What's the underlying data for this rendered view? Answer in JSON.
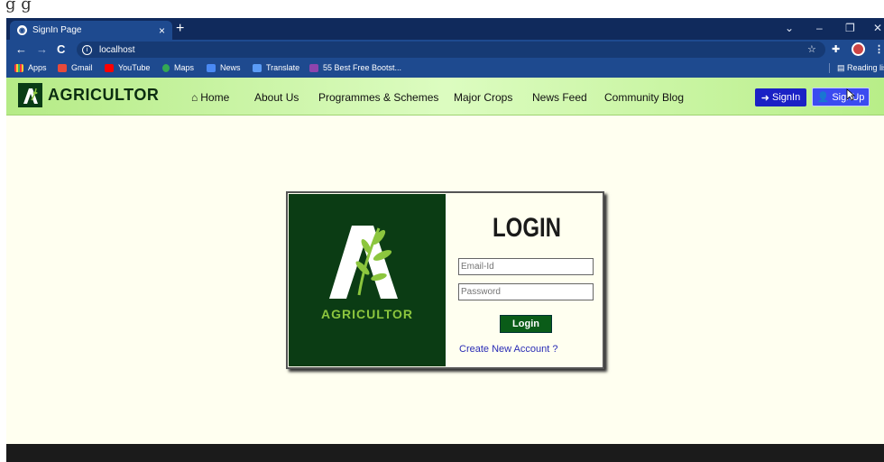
{
  "top_strip": {
    "partial_text": "g                                                           g"
  },
  "browser": {
    "tab_title": "SignIn Page",
    "tab_close": "×",
    "new_tab": "+",
    "win_controls": [
      "⌄",
      "–",
      "❐",
      "✕"
    ],
    "url": "localhost",
    "bookmarks": [
      "Apps",
      "Gmail",
      "YouTube",
      "Maps",
      "News",
      "Translate",
      "55 Best Free Bootst..."
    ],
    "reading_list": "Reading list"
  },
  "site": {
    "brand": "AGRICULTOR",
    "nav": [
      "Home",
      "About Us",
      "Programmes & Schemes",
      "Major Crops",
      "News Feed",
      "Community Blog"
    ],
    "signin": "SignIn",
    "signup": "SignUp"
  },
  "login": {
    "brand": "AGRICULTOR",
    "title": "LOGIN",
    "email_placeholder": "Email-Id",
    "password_placeholder": "Password",
    "button": "Login",
    "create_link": "Create New Account ?"
  },
  "colors": {
    "nav_gradient": "#c8f4a0",
    "card_dark": "#0b3c14",
    "accent_green": "#8cc63e",
    "signin_blue": "#1a21c5",
    "tab_navy": "#102a5c"
  }
}
